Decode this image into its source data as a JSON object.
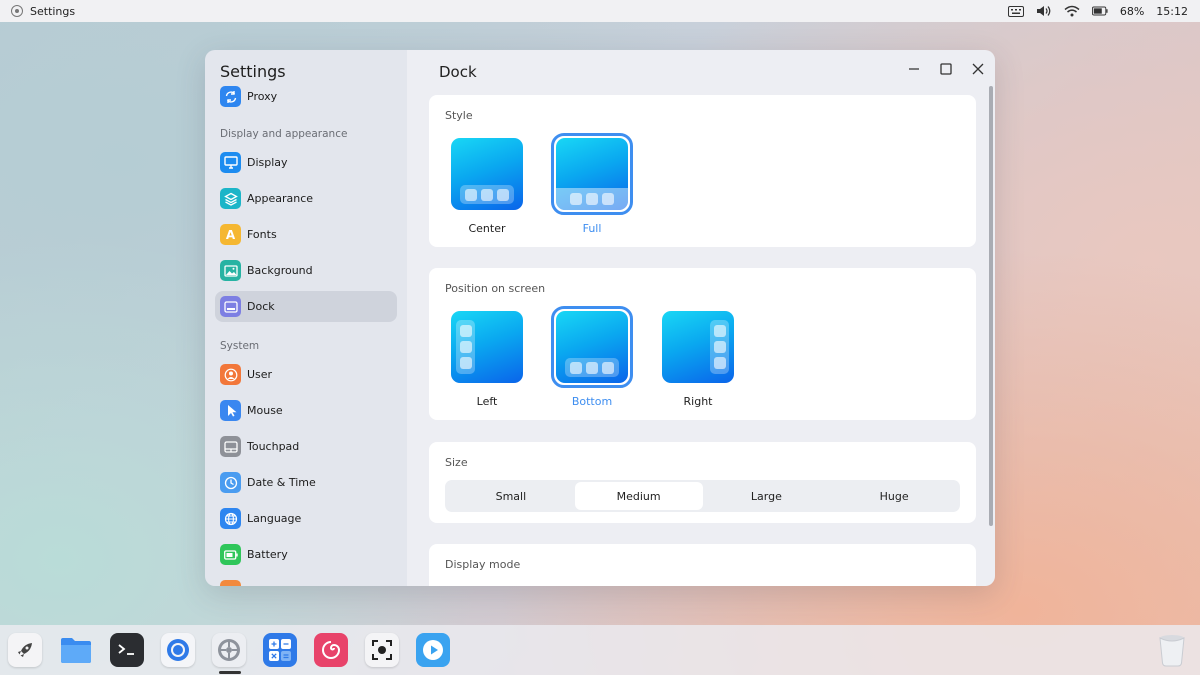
{
  "topbar": {
    "app_name": "Settings",
    "battery": "68%",
    "time": "15:12"
  },
  "sidebar": {
    "title": "Settings",
    "proxy": "Proxy",
    "section_display": "Display and appearance",
    "items_display": [
      {
        "label": "Display",
        "icon": "monitor-icon",
        "color": "#1d8cf0"
      },
      {
        "label": "Appearance",
        "icon": "layers-icon",
        "color": "#1cb5c8"
      },
      {
        "label": "Fonts",
        "icon": "font-icon",
        "color": "#f5b731"
      },
      {
        "label": "Background",
        "icon": "image-icon",
        "color": "#27b3a3"
      },
      {
        "label": "Dock",
        "icon": "dock-icon",
        "color": "#7d7fe3"
      }
    ],
    "section_system": "System",
    "items_system": [
      {
        "label": "User",
        "icon": "user-icon",
        "color": "#f2773a"
      },
      {
        "label": "Mouse",
        "icon": "cursor-icon",
        "color": "#3a87f0"
      },
      {
        "label": "Touchpad",
        "icon": "touchpad-icon",
        "color": "#8e9198"
      },
      {
        "label": "Date & Time",
        "icon": "clock-icon",
        "color": "#4a9cf0"
      },
      {
        "label": "Language",
        "icon": "globe-icon",
        "color": "#2e86f0"
      },
      {
        "label": "Battery",
        "icon": "battery-icon",
        "color": "#2fc65a"
      }
    ]
  },
  "content": {
    "title": "Dock",
    "style": {
      "label": "Style",
      "options": [
        "Center",
        "Full"
      ],
      "selected": "Full"
    },
    "position": {
      "label": "Position on screen",
      "options": [
        "Left",
        "Bottom",
        "Right"
      ],
      "selected": "Bottom"
    },
    "size": {
      "label": "Size",
      "options": [
        "Small",
        "Medium",
        "Large",
        "Huge"
      ],
      "selected": "Medium"
    },
    "display_mode": {
      "label": "Display mode"
    }
  },
  "accent": "#3e8ef0"
}
